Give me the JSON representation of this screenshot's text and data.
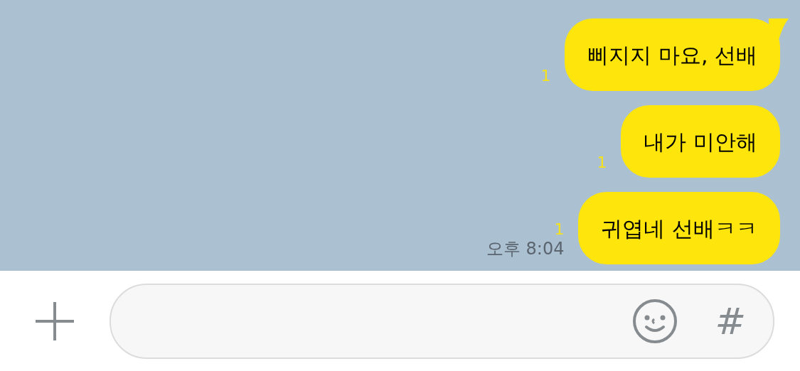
{
  "messages": [
    {
      "text": "삐지지 마요, 선배",
      "unread": "1",
      "tail": true
    },
    {
      "text": "내가 미안해",
      "unread": "1",
      "tail": false
    },
    {
      "text": "귀엽네 선배ㅋㅋ",
      "unread": "1",
      "tail": false,
      "time": "오후 8:04"
    }
  ],
  "composer": {
    "hash": "#"
  }
}
